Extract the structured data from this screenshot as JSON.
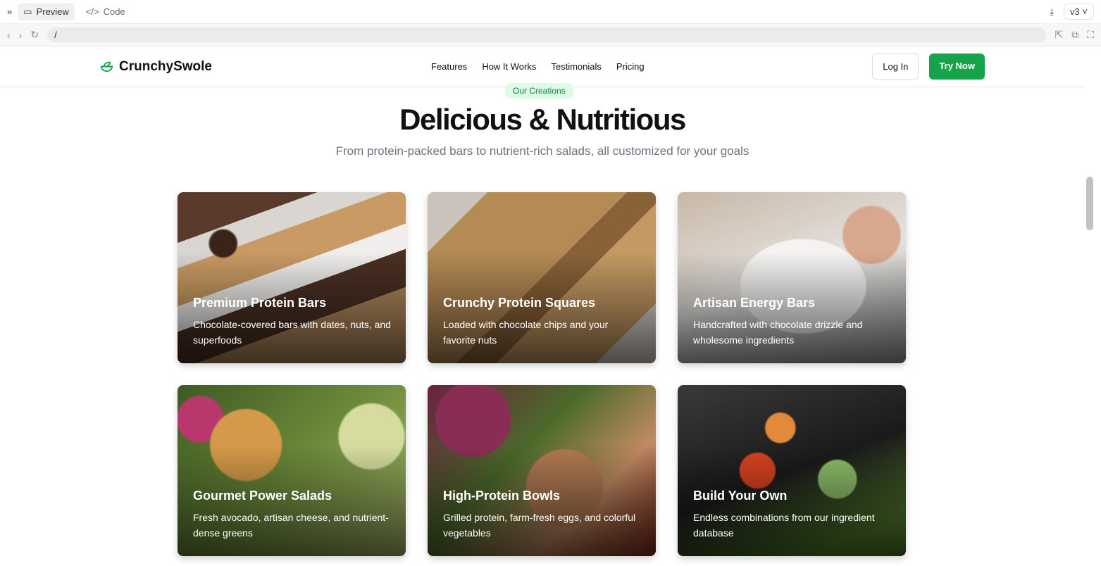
{
  "toolbar": {
    "preview": "Preview",
    "code": "Code",
    "version": "v3"
  },
  "address": {
    "url": "/"
  },
  "nav": {
    "brand": "CrunchySwole",
    "links": [
      "Features",
      "How It Works",
      "Testimonials",
      "Pricing"
    ],
    "login": "Log In",
    "try": "Try Now"
  },
  "hero": {
    "badge": "Our Creations",
    "title": "Delicious & Nutritious",
    "subtitle": "From protein-packed bars to nutrient-rich salads, all customized for your goals"
  },
  "cards": [
    {
      "title": "Premium Protein Bars",
      "desc": "Chocolate-covered bars with dates, nuts, and superfoods"
    },
    {
      "title": "Crunchy Protein Squares",
      "desc": "Loaded with chocolate chips and your favorite nuts"
    },
    {
      "title": "Artisan Energy Bars",
      "desc": "Handcrafted with chocolate drizzle and wholesome ingredients"
    },
    {
      "title": "Gourmet Power Salads",
      "desc": "Fresh avocado, artisan cheese, and nutrient-dense greens"
    },
    {
      "title": "High-Protein Bowls",
      "desc": "Grilled protein, farm-fresh eggs, and colorful vegetables"
    },
    {
      "title": "Build Your Own",
      "desc": "Endless combinations from our ingredient database"
    }
  ],
  "colors": {
    "accent": "#16a34a"
  }
}
